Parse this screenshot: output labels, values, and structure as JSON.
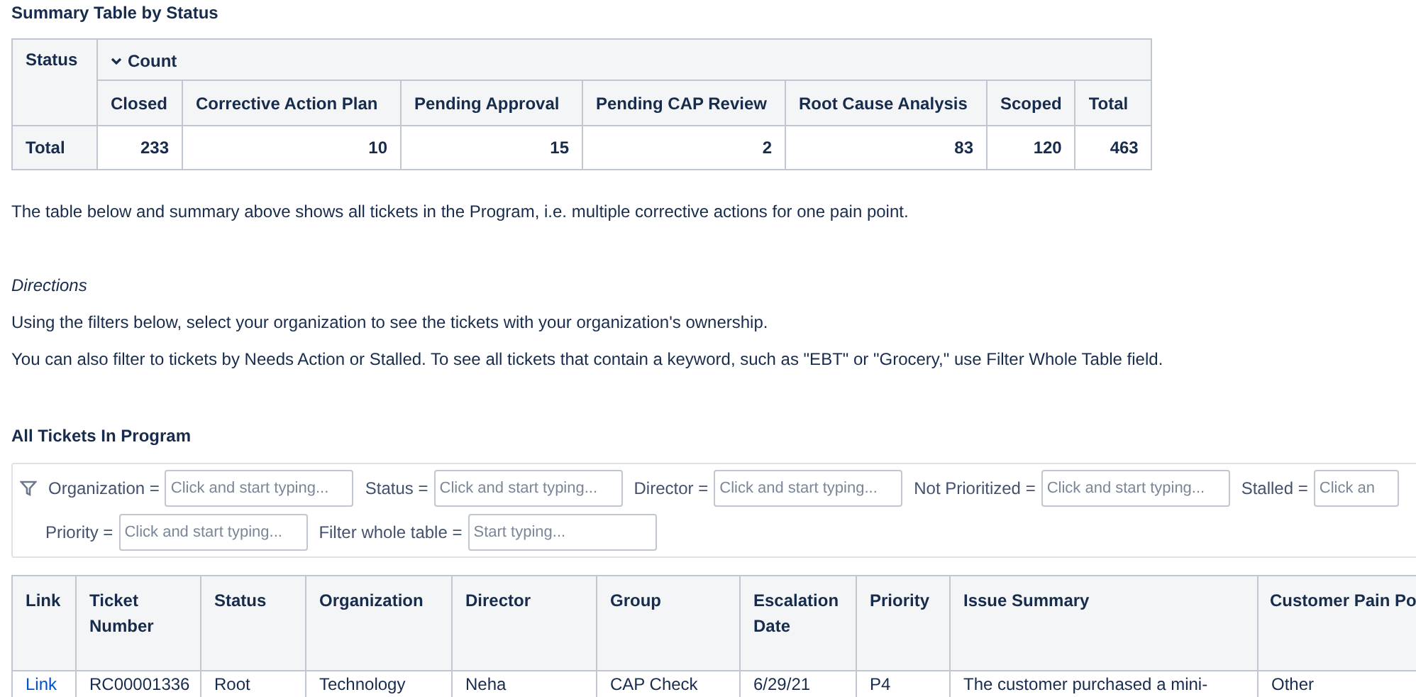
{
  "summary": {
    "title": "Summary Table by Status",
    "row_header": "Status",
    "group_header": "Count",
    "group_expanded": true,
    "columns": [
      "Closed",
      "Corrective Action Plan",
      "Pending Approval",
      "Pending CAP Review",
      "Root Cause Analysis",
      "Scoped",
      "Total"
    ],
    "row": {
      "label": "Total",
      "values": [
        "233",
        "10",
        "15",
        "2",
        "83",
        "120",
        "463"
      ]
    }
  },
  "note": "The table below and summary above shows all tickets in the Program, i.e. multiple corrective actions for one pain point.",
  "directions": {
    "heading": "Directions",
    "lines": [
      "Using the filters below, select your organization to see the tickets with your organization's ownership.",
      "You can also filter to tickets by Needs Action or Stalled. To see all tickets that contain a keyword, such as \"EBT\" or \"Grocery,\" use Filter Whole Table field."
    ]
  },
  "tickets": {
    "title": "All Tickets In Program",
    "filters": [
      {
        "label": "Organization =",
        "placeholder": "Click and start typing..."
      },
      {
        "label": "Status =",
        "placeholder": "Click and start typing..."
      },
      {
        "label": "Director =",
        "placeholder": "Click and start typing..."
      },
      {
        "label": "Not Prioritized =",
        "placeholder": "Click and start typing..."
      },
      {
        "label": "Stalled =",
        "placeholder": "Click an"
      },
      {
        "label": "Priority =",
        "placeholder": "Click and start typing..."
      },
      {
        "label": "Filter whole table =",
        "placeholder": "Start typing..."
      }
    ],
    "columns": [
      "Link",
      "Ticket Number",
      "Status",
      "Organization",
      "Director",
      "Group",
      "Escalation Date",
      "Priority",
      "Issue Summary",
      "Customer Pain Po"
    ],
    "rows": [
      [
        "Link",
        "RC00001336",
        "Root",
        "Technology",
        "Neha",
        "CAP Check",
        "6/29/21",
        "P4",
        "The customer purchased a mini-",
        "Other"
      ]
    ]
  }
}
